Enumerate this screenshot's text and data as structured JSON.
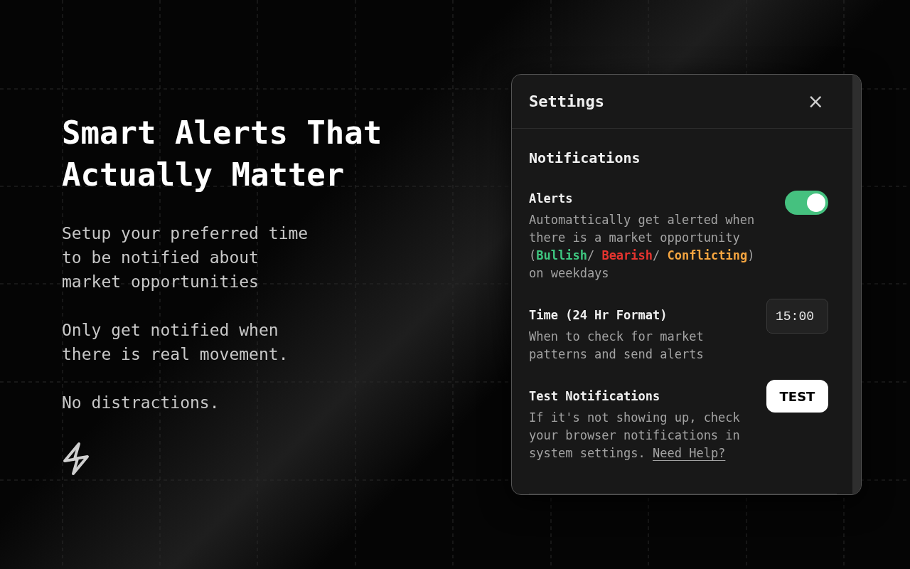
{
  "hero": {
    "title": "Smart Alerts That Actually Matter",
    "paragraphs": [
      "Setup your preferred time to be notified about market opportunities",
      "Only get notified when there is real movement.",
      "No distractions."
    ]
  },
  "settings": {
    "title": "Settings",
    "close": "×",
    "section": "Notifications",
    "items": [
      {
        "kind": "toggle",
        "label": "Alerts",
        "on": true,
        "description": [
          {
            "text": "Automattically get alerted when there is a market opportunity ("
          },
          {
            "text": "Bullish",
            "color": "#3ec57f"
          },
          {
            "text": "/ "
          },
          {
            "text": "Bearish",
            "color": "#e5342f"
          },
          {
            "text": "/ "
          },
          {
            "text": "Conflicting",
            "color": "#f5a540"
          },
          {
            "text": ") on weekdays"
          }
        ]
      },
      {
        "kind": "time",
        "label": "Time (24 Hr Format)",
        "value": "15:00",
        "description": [
          {
            "text": "When to check for market patterns and send alerts"
          }
        ]
      },
      {
        "kind": "button",
        "label": "Test Notifications",
        "button": "TEST",
        "description": [
          {
            "text": "If it's not showing up, check your browser notifications in system settings. "
          }
        ],
        "link": "Need Help?"
      }
    ]
  }
}
